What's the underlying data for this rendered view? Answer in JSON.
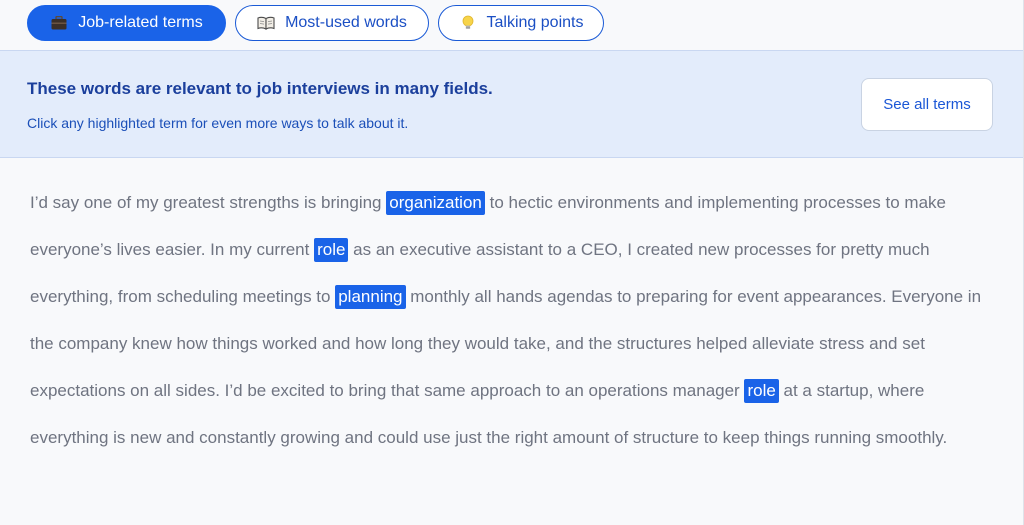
{
  "tabs": [
    {
      "label": "Job-related terms",
      "icon": "briefcase-icon",
      "active": true
    },
    {
      "label": "Most-used words",
      "icon": "book-icon",
      "active": false
    },
    {
      "label": "Talking points",
      "icon": "lightbulb-icon",
      "active": false
    }
  ],
  "banner": {
    "title": "These words are relevant to job interviews in many fields.",
    "subtitle": "Click any highlighted term for even more ways to talk about it.",
    "button_label": "See all terms"
  },
  "answer": {
    "seg1": "I’d say one of my greatest strengths is bringing ",
    "term1": "organization",
    "seg2": " to hectic environments and implementing processes to make everyone’s lives easier. In my current ",
    "term2": "role",
    "seg3": " as an executive assistant to a CEO, I created new processes for pretty much everything, from scheduling meetings to ",
    "term3": "planning",
    "seg4": " monthly all hands agendas to preparing for event appearances. Everyone in the company knew how things worked and how long they would take, and the structures helped alleviate stress and set expectations on all sides. I’d be excited to bring that same approach to an operations manager ",
    "term4": "role",
    "seg5": " at a startup, where everything is new and constantly growing and could use just the right amount of structure to keep things running smoothly."
  },
  "colors": {
    "accent": "#1a63e8",
    "banner_bg": "#e3ecfb",
    "body_text": "#6f7481"
  }
}
